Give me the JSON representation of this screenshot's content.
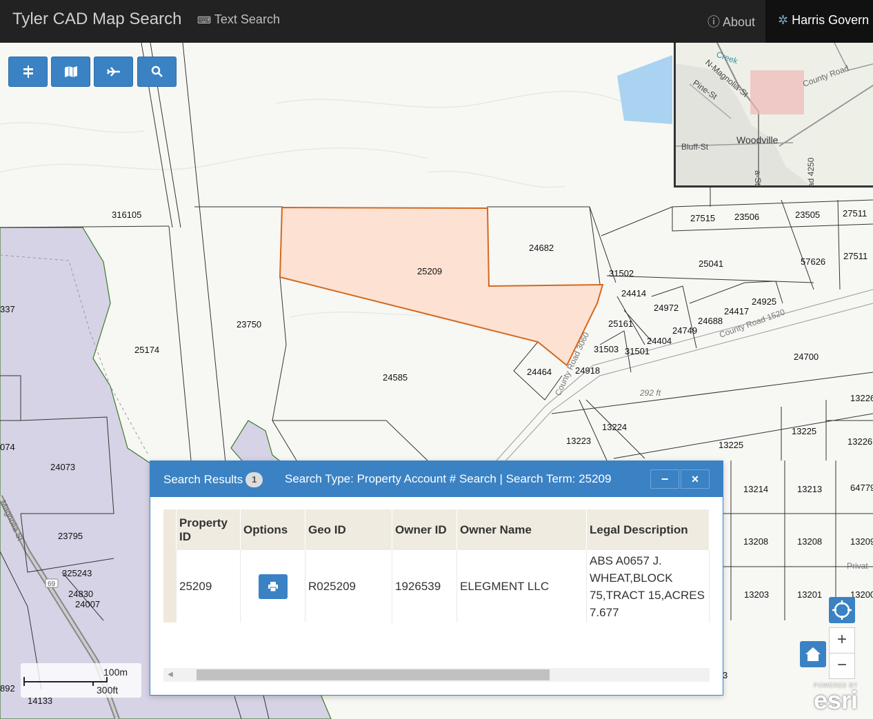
{
  "navbar": {
    "title": "Tyler CAD Map Search",
    "text_search": "Text Search",
    "about": "About",
    "org": "Harris Govern"
  },
  "toolbar": [
    {
      "icon": "layers-icon"
    },
    {
      "icon": "map-icon"
    },
    {
      "icon": "plane-icon"
    },
    {
      "icon": "search-icon"
    }
  ],
  "overview": {
    "labels": [
      "Creek",
      "N-Magnolia-St",
      "Pine-St",
      "County Road",
      "Woodville",
      "Bluff-St",
      "a-St",
      "ad 4250"
    ]
  },
  "map": {
    "selected_parcel": "25209",
    "parcels": [
      "316105",
      "25174",
      "23750",
      "24585",
      "24682",
      "24464",
      "24918",
      "31502",
      "24414",
      "24972",
      "25161",
      "31503",
      "31501",
      "24404",
      "24749",
      "24688",
      "24417",
      "24925",
      "25041",
      "27515",
      "23506",
      "23505",
      "27511",
      "27511",
      "57626",
      "24700",
      "13224",
      "13223",
      "13225",
      "13225",
      "13226",
      "13226",
      "24073",
      "23795",
      "325243",
      "24830",
      "24007",
      "14133",
      "13214",
      "13213",
      "64779",
      "13208",
      "13208",
      "13209",
      "13203",
      "13201",
      "13200",
      "337",
      "074",
      "892",
      "3"
    ],
    "roads": [
      "County Road 3060",
      "County Road 1520",
      "Magnolia St",
      "69",
      "Privat"
    ],
    "elevation": "292 ft"
  },
  "results": {
    "title": "Search Results",
    "count": "1",
    "summary": "Search Type: Property Account # Search | Search Term: 25209",
    "minimize": "−",
    "close": "×",
    "columns": [
      "Property ID",
      "Options",
      "Geo ID",
      "Owner ID",
      "Owner Name",
      "Legal Description"
    ],
    "rows": [
      {
        "property_id": "25209",
        "geo_id": "R025209",
        "owner_id": "1926539",
        "owner_name": "ELEGMENT LLC",
        "legal": "ABS A0657 J. WHEAT,BLOCK 75,TRACT 15,ACRES 7.677"
      }
    ]
  },
  "scalebar": {
    "metric": "100m",
    "imperial": "300ft"
  },
  "controls": {
    "zoom_in": "+",
    "zoom_out": "−"
  },
  "attribution": {
    "powered": "POWERED BY",
    "brand": "esri"
  }
}
